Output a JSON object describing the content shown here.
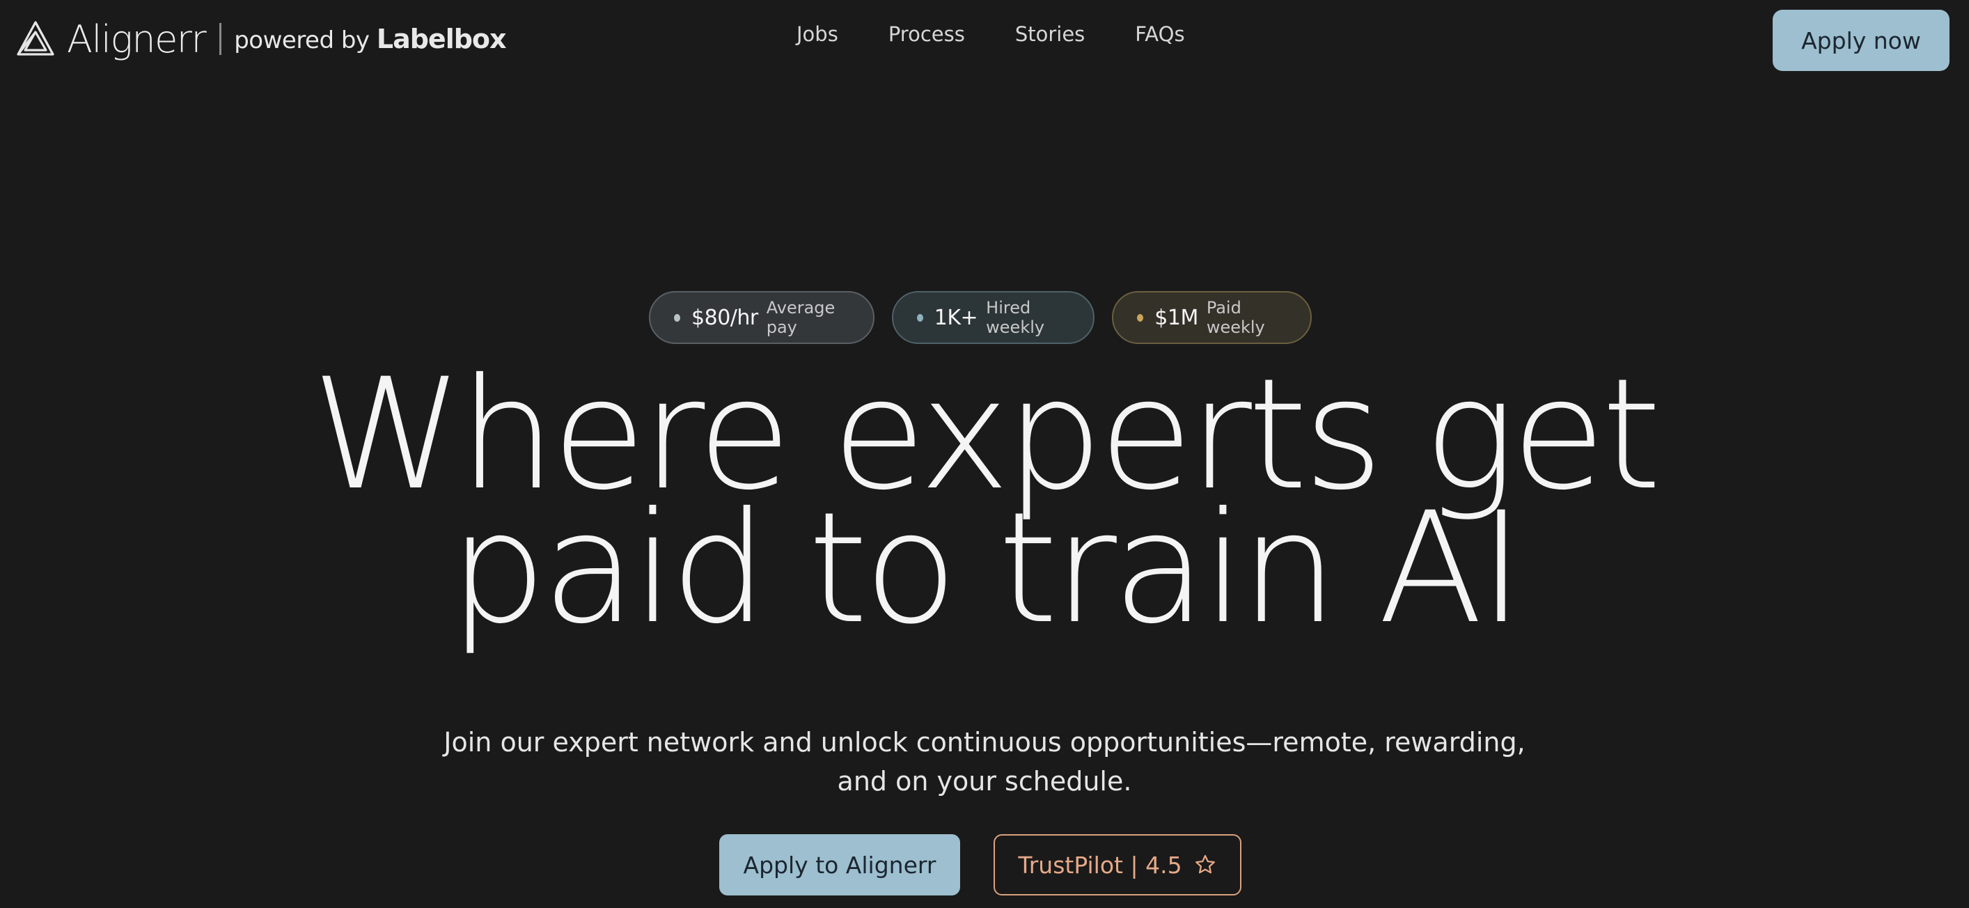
{
  "header": {
    "brand": {
      "name": "Alignerr",
      "powered_prefix": "powered by",
      "powered_brand": "Labelbox",
      "logo_icon": "triangle-logo-icon"
    },
    "nav": [
      {
        "label": "Jobs"
      },
      {
        "label": "Process"
      },
      {
        "label": "Stories"
      },
      {
        "label": "FAQs"
      }
    ],
    "apply_now_label": "Apply now"
  },
  "stats": [
    {
      "value": "$80/hr",
      "label": "Average pay",
      "dot_color": "#b9c3c6"
    },
    {
      "value": "1K+",
      "label": "Hired weekly",
      "dot_color": "#8fb0bd"
    },
    {
      "value": "$1M",
      "label": "Paid weekly",
      "dot_color": "#c9a55a"
    }
  ],
  "hero": {
    "title_line_1": "Where experts get",
    "title_line_2": "paid to train AI",
    "subtitle_line_1": "Join our expert network and unlock continuous opportunities—remote, rewarding,",
    "subtitle_line_2": "and on your schedule."
  },
  "cta": {
    "primary_label": "Apply to Alignerr",
    "secondary_label": "TrustPilot | 4.5",
    "secondary_icon": "star-icon"
  },
  "colors": {
    "background": "#1a1a1a",
    "accent": "#9dbfcf",
    "trustpilot_accent": "#d9a27e"
  }
}
